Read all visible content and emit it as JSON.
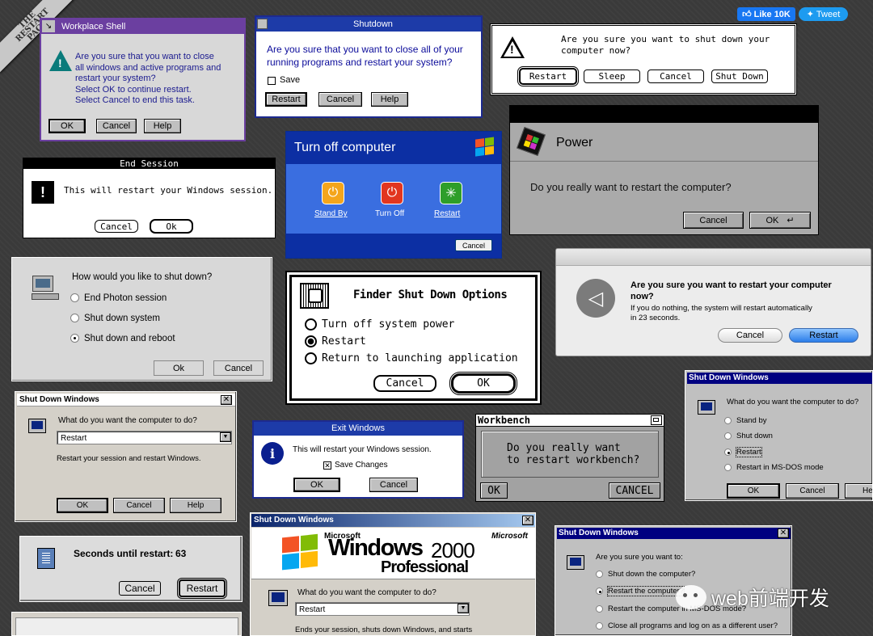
{
  "corner_ribbon": "THE RESTART PAGE",
  "social": {
    "like": "Like 10K",
    "tweet": "Tweet"
  },
  "watermark": "web前端开发",
  "wps": {
    "title": "Workplace Shell",
    "message": [
      "Are you sure that you want to close",
      "all windows and active programs and",
      "restart your system?",
      "Select OK to continue restart.",
      "Select Cancel to end this task."
    ],
    "ok": "OK",
    "cancel": "Cancel",
    "help": "Help"
  },
  "w31": {
    "title": "Shutdown",
    "message": [
      "Are you sure that you want to close all of your",
      "running programs and restart your system?"
    ],
    "save": "Save",
    "restart": "Restart",
    "cancel": "Cancel",
    "help": "Help"
  },
  "mac1": {
    "message": [
      "Are you sure you want to shut down your",
      "computer now?"
    ],
    "restart": "Restart",
    "sleep": "Sleep",
    "cancel": "Cancel",
    "shutdown": "Shut Down"
  },
  "endsess": {
    "title": "End Session",
    "message": "This will restart your Windows session.",
    "cancel": "Cancel",
    "ok": "Ok"
  },
  "xp": {
    "title": "Turn off computer",
    "standby": "Stand By",
    "turnoff": "Turn Off",
    "restart": "Restart",
    "cancel": "Cancel"
  },
  "next": {
    "title": "Power",
    "message": "Do you really want to restart the computer?",
    "cancel": "Cancel",
    "ok": "OK"
  },
  "photon": {
    "question": "How would you like to shut down?",
    "options": [
      "End Photon session",
      "Shut down system",
      "Shut down and reboot"
    ],
    "ok": "Ok",
    "cancel": "Cancel"
  },
  "finder": {
    "title": "Finder Shut Down Options",
    "options": [
      "Turn off system power",
      "Restart",
      "Return to launching application"
    ],
    "cancel": "Cancel",
    "ok": "OK"
  },
  "osx": {
    "message": [
      "Are you sure you want to restart your computer",
      "now?"
    ],
    "sub": [
      "If you do nothing, the system will restart automatically",
      "in 23 seconds."
    ],
    "cancel": "Cancel",
    "restart": "Restart"
  },
  "w98": {
    "title": "Shut Down Windows",
    "question": "What do you want the computer to do?",
    "selected": "Restart",
    "desc": "Restart your session and restart Windows.",
    "ok": "OK",
    "cancel": "Cancel",
    "help": "Help"
  },
  "exitwin": {
    "title": "Exit Windows",
    "message": "This will restart your Windows session.",
    "save": "Save Changes",
    "ok": "OK",
    "cancel": "Cancel"
  },
  "amiga": {
    "title": "Workbench",
    "message": [
      "Do you really want",
      "to restart workbench?"
    ],
    "ok": "OK",
    "cancel": "CANCEL"
  },
  "w95b": {
    "title": "Shut Down Windows",
    "question": "What do you want the computer to do?",
    "options": [
      "Stand by",
      "Shut down",
      "Restart",
      "Restart in MS-DOS mode"
    ],
    "ok": "OK",
    "cancel": "Cancel",
    "help": "He"
  },
  "countdown": {
    "label": "Seconds until restart:",
    "value": "63",
    "cancel": "Cancel",
    "restart": "Restart"
  },
  "w2k": {
    "title": "Shut Down Windows",
    "brand": "Microsoft",
    "win": "Windows",
    "ver": "2000",
    "edition": "Professional",
    "question": "What do you want the computer to do?",
    "selected": "Restart",
    "desc": "Ends your session, shuts down Windows, and starts"
  },
  "w95": {
    "title": "Shut Down Windows",
    "question": "Are you sure you want to:",
    "options": [
      "Shut down the computer?",
      "Restart the computer?",
      "Restart the computer in MS-DOS mode?",
      "Close all programs and log on as a different user?"
    ]
  }
}
